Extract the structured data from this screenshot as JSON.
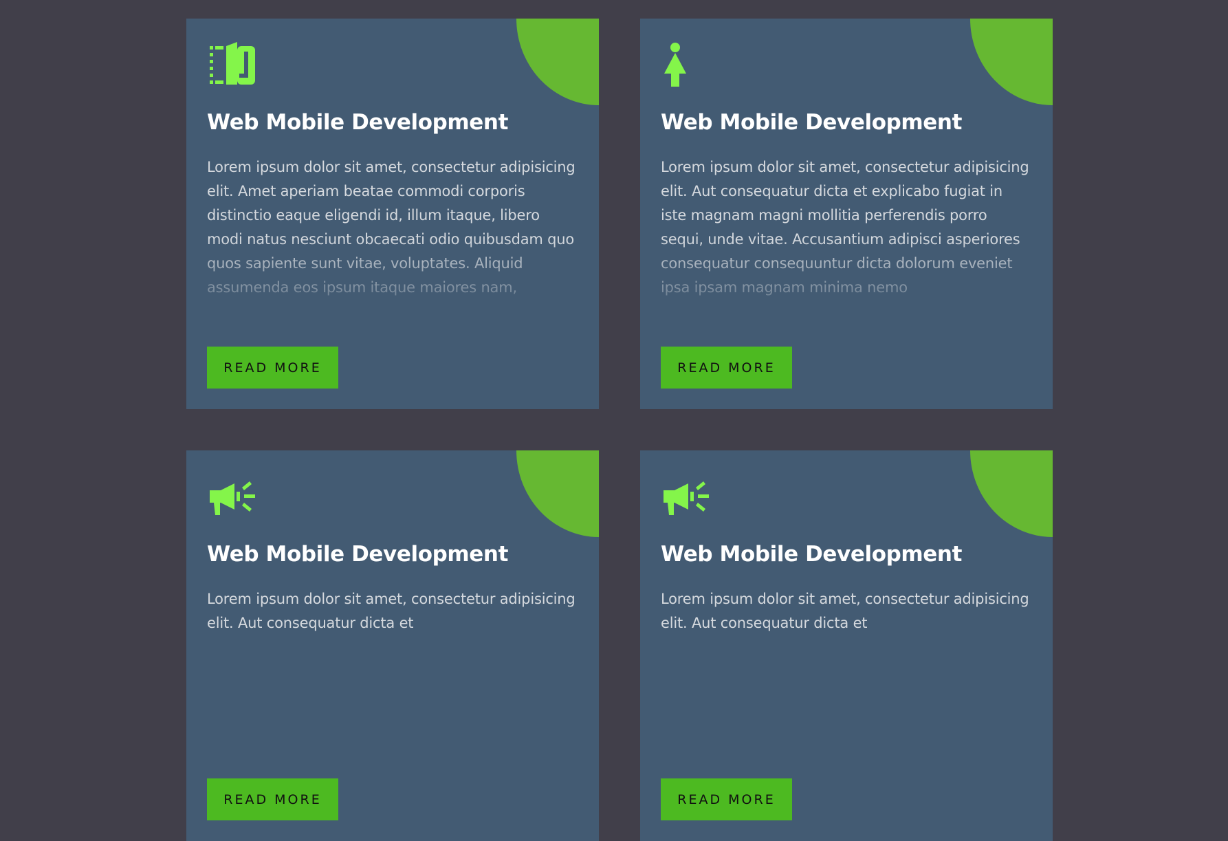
{
  "colors": {
    "background": "#413f4a",
    "card": "#435b73",
    "accent": "#66b832",
    "button": "#4dba21",
    "icon": "#84f54a"
  },
  "cards": [
    {
      "icon": "book-icon",
      "title": "Web Mobile Development",
      "description": "Lorem ipsum dolor sit amet, consectetur adipisicing elit. Amet aperiam beatae commodi corporis distinctio eaque eligendi id, illum itaque, libero modi natus nesciunt obcaecati odio quibusdam quo quos sapiente sunt vitae, voluptates. Aliquid assumenda eos ipsum itaque maiores nam,",
      "button_label": "READ MORE"
    },
    {
      "icon": "female-icon",
      "title": "Web Mobile Development",
      "description": "Lorem ipsum dolor sit amet, consectetur adipisicing elit. Aut consequatur dicta et explicabo fugiat in iste magnam magni mollitia perferendis porro sequi, unde vitae. Accusantium adipisci asperiores consequatur consequuntur dicta dolorum eveniet ipsa ipsam magnam minima nemo",
      "button_label": "READ MORE"
    },
    {
      "icon": "megaphone-icon",
      "title": "Web Mobile Development",
      "description": "Lorem ipsum dolor sit amet, consectetur adipisicing elit. Aut consequatur dicta et",
      "button_label": "READ MORE"
    },
    {
      "icon": "megaphone-icon",
      "title": "Web Mobile Development",
      "description": "Lorem ipsum dolor sit amet, consectetur adipisicing elit. Aut consequatur dicta et",
      "button_label": "READ MORE"
    }
  ]
}
